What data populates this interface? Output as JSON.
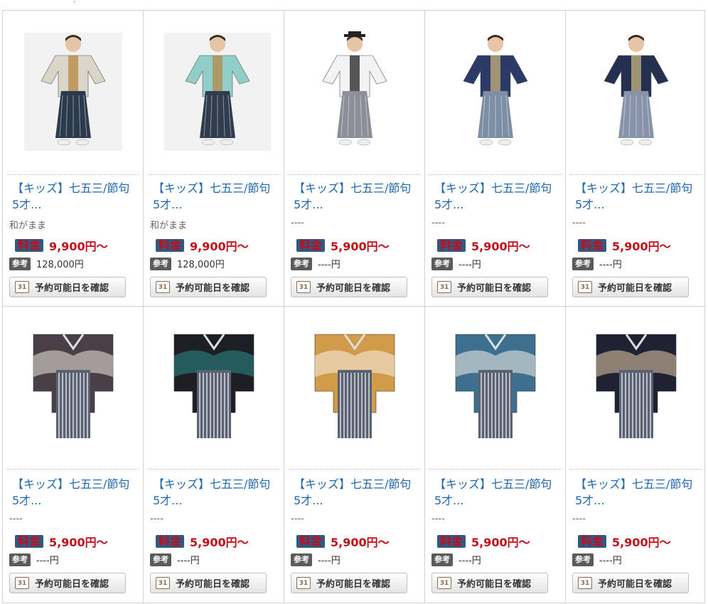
{
  "products": [
    {
      "title": "【キッズ】七五三/節句 5才...",
      "brand": "和がまま",
      "price_tag": "料金",
      "price": "9,900円〜",
      "ref_tag": "参考",
      "ref": "128,000円",
      "button": "予約可能日を確認",
      "calendar_icon": "31",
      "colors": {
        "robe": "#d9d6c8",
        "hakama": "#2c3a4e",
        "accent": "#b8873f"
      }
    },
    {
      "title": "【キッズ】七五三/節句 5才...",
      "brand": "和がまま",
      "price_tag": "料金",
      "price": "9,900円〜",
      "ref_tag": "参考",
      "ref": "128,000円",
      "button": "予約可能日を確認",
      "calendar_icon": "31",
      "colors": {
        "robe": "#8fcfc7",
        "hakama": "#2f3d4f",
        "accent": "#b58a4a"
      }
    },
    {
      "title": "【キッズ】七五三/節句 5才...",
      "brand": "----",
      "price_tag": "料金",
      "price": "5,900円〜",
      "ref_tag": "参考",
      "ref": "----円",
      "button": "予約可能日を確認",
      "calendar_icon": "31",
      "colors": {
        "robe": "#f3f3f3",
        "hakama": "#8a8f98",
        "accent": "#222222"
      }
    },
    {
      "title": "【キッズ】七五三/節句 5才...",
      "brand": "----",
      "price_tag": "料金",
      "price": "5,900円〜",
      "ref_tag": "参考",
      "ref": "----円",
      "button": "予約可能日を確認",
      "calendar_icon": "31",
      "colors": {
        "robe": "#2b3a66",
        "hakama": "#7e8ea6",
        "accent": "#c7b37b"
      }
    },
    {
      "title": "【キッズ】七五三/節句 5才...",
      "brand": "----",
      "price_tag": "料金",
      "price": "5,900円〜",
      "ref_tag": "参考",
      "ref": "----円",
      "button": "予約可能日を確認",
      "calendar_icon": "31",
      "colors": {
        "robe": "#23304f",
        "hakama": "#8693aa",
        "accent": "#c9b57e"
      }
    },
    {
      "title": "【キッズ】七五三/節句 5才...",
      "brand": "----",
      "price_tag": "料金",
      "price": "5,900円〜",
      "ref_tag": "参考",
      "ref": "----円",
      "button": "予約可能日を確認",
      "calendar_icon": "31",
      "colors": {
        "robe": "#4a3f47",
        "hakama": "#5a6173",
        "accent": "#efe9df"
      }
    },
    {
      "title": "【キッズ】七五三/節句 5才...",
      "brand": "----",
      "price_tag": "料金",
      "price": "5,900円〜",
      "ref_tag": "参考",
      "ref": "----円",
      "button": "予約可能日を確認",
      "calendar_icon": "31",
      "colors": {
        "robe": "#1d1f24",
        "hakama": "#5a6173",
        "accent": "#2e8c8e"
      }
    },
    {
      "title": "【キッズ】七五三/節句 5才...",
      "brand": "----",
      "price_tag": "料金",
      "price": "5,900円〜",
      "ref_tag": "参考",
      "ref": "----円",
      "button": "予約可能日を確認",
      "calendar_icon": "31",
      "colors": {
        "robe": "#d29b4a",
        "hakama": "#5a6173",
        "accent": "#f5f3ea"
      }
    },
    {
      "title": "【キッズ】七五三/節句 5才...",
      "brand": "----",
      "price_tag": "料金",
      "price": "5,900円〜",
      "ref_tag": "参考",
      "ref": "----円",
      "button": "予約可能日を確認",
      "calendar_icon": "31",
      "colors": {
        "robe": "#3d6f8f",
        "hakama": "#5a6173",
        "accent": "#f5f3ea"
      }
    },
    {
      "title": "【キッズ】七五三/節句 5才...",
      "brand": "----",
      "price_tag": "料金",
      "price": "5,900円〜",
      "ref_tag": "参考",
      "ref": "----円",
      "button": "予約可能日を確認",
      "calendar_icon": "31",
      "colors": {
        "robe": "#1f2233",
        "hakama": "#5a6173",
        "accent": "#e7cfaa"
      }
    }
  ]
}
